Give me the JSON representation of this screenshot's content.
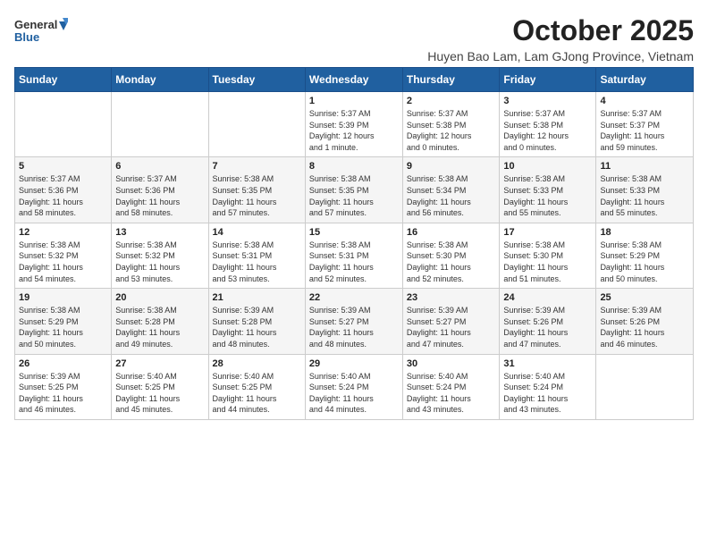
{
  "header": {
    "logo_general": "General",
    "logo_blue": "Blue",
    "month_title": "October 2025",
    "subtitle": "Huyen Bao Lam, Lam GJong Province, Vietnam"
  },
  "weekdays": [
    "Sunday",
    "Monday",
    "Tuesday",
    "Wednesday",
    "Thursday",
    "Friday",
    "Saturday"
  ],
  "weeks": [
    [
      {
        "day": "",
        "info": ""
      },
      {
        "day": "",
        "info": ""
      },
      {
        "day": "",
        "info": ""
      },
      {
        "day": "1",
        "info": "Sunrise: 5:37 AM\nSunset: 5:39 PM\nDaylight: 12 hours\nand 1 minute."
      },
      {
        "day": "2",
        "info": "Sunrise: 5:37 AM\nSunset: 5:38 PM\nDaylight: 12 hours\nand 0 minutes."
      },
      {
        "day": "3",
        "info": "Sunrise: 5:37 AM\nSunset: 5:38 PM\nDaylight: 12 hours\nand 0 minutes."
      },
      {
        "day": "4",
        "info": "Sunrise: 5:37 AM\nSunset: 5:37 PM\nDaylight: 11 hours\nand 59 minutes."
      }
    ],
    [
      {
        "day": "5",
        "info": "Sunrise: 5:37 AM\nSunset: 5:36 PM\nDaylight: 11 hours\nand 58 minutes."
      },
      {
        "day": "6",
        "info": "Sunrise: 5:37 AM\nSunset: 5:36 PM\nDaylight: 11 hours\nand 58 minutes."
      },
      {
        "day": "7",
        "info": "Sunrise: 5:38 AM\nSunset: 5:35 PM\nDaylight: 11 hours\nand 57 minutes."
      },
      {
        "day": "8",
        "info": "Sunrise: 5:38 AM\nSunset: 5:35 PM\nDaylight: 11 hours\nand 57 minutes."
      },
      {
        "day": "9",
        "info": "Sunrise: 5:38 AM\nSunset: 5:34 PM\nDaylight: 11 hours\nand 56 minutes."
      },
      {
        "day": "10",
        "info": "Sunrise: 5:38 AM\nSunset: 5:33 PM\nDaylight: 11 hours\nand 55 minutes."
      },
      {
        "day": "11",
        "info": "Sunrise: 5:38 AM\nSunset: 5:33 PM\nDaylight: 11 hours\nand 55 minutes."
      }
    ],
    [
      {
        "day": "12",
        "info": "Sunrise: 5:38 AM\nSunset: 5:32 PM\nDaylight: 11 hours\nand 54 minutes."
      },
      {
        "day": "13",
        "info": "Sunrise: 5:38 AM\nSunset: 5:32 PM\nDaylight: 11 hours\nand 53 minutes."
      },
      {
        "day": "14",
        "info": "Sunrise: 5:38 AM\nSunset: 5:31 PM\nDaylight: 11 hours\nand 53 minutes."
      },
      {
        "day": "15",
        "info": "Sunrise: 5:38 AM\nSunset: 5:31 PM\nDaylight: 11 hours\nand 52 minutes."
      },
      {
        "day": "16",
        "info": "Sunrise: 5:38 AM\nSunset: 5:30 PM\nDaylight: 11 hours\nand 52 minutes."
      },
      {
        "day": "17",
        "info": "Sunrise: 5:38 AM\nSunset: 5:30 PM\nDaylight: 11 hours\nand 51 minutes."
      },
      {
        "day": "18",
        "info": "Sunrise: 5:38 AM\nSunset: 5:29 PM\nDaylight: 11 hours\nand 50 minutes."
      }
    ],
    [
      {
        "day": "19",
        "info": "Sunrise: 5:38 AM\nSunset: 5:29 PM\nDaylight: 11 hours\nand 50 minutes."
      },
      {
        "day": "20",
        "info": "Sunrise: 5:38 AM\nSunset: 5:28 PM\nDaylight: 11 hours\nand 49 minutes."
      },
      {
        "day": "21",
        "info": "Sunrise: 5:39 AM\nSunset: 5:28 PM\nDaylight: 11 hours\nand 48 minutes."
      },
      {
        "day": "22",
        "info": "Sunrise: 5:39 AM\nSunset: 5:27 PM\nDaylight: 11 hours\nand 48 minutes."
      },
      {
        "day": "23",
        "info": "Sunrise: 5:39 AM\nSunset: 5:27 PM\nDaylight: 11 hours\nand 47 minutes."
      },
      {
        "day": "24",
        "info": "Sunrise: 5:39 AM\nSunset: 5:26 PM\nDaylight: 11 hours\nand 47 minutes."
      },
      {
        "day": "25",
        "info": "Sunrise: 5:39 AM\nSunset: 5:26 PM\nDaylight: 11 hours\nand 46 minutes."
      }
    ],
    [
      {
        "day": "26",
        "info": "Sunrise: 5:39 AM\nSunset: 5:25 PM\nDaylight: 11 hours\nand 46 minutes."
      },
      {
        "day": "27",
        "info": "Sunrise: 5:40 AM\nSunset: 5:25 PM\nDaylight: 11 hours\nand 45 minutes."
      },
      {
        "day": "28",
        "info": "Sunrise: 5:40 AM\nSunset: 5:25 PM\nDaylight: 11 hours\nand 44 minutes."
      },
      {
        "day": "29",
        "info": "Sunrise: 5:40 AM\nSunset: 5:24 PM\nDaylight: 11 hours\nand 44 minutes."
      },
      {
        "day": "30",
        "info": "Sunrise: 5:40 AM\nSunset: 5:24 PM\nDaylight: 11 hours\nand 43 minutes."
      },
      {
        "day": "31",
        "info": "Sunrise: 5:40 AM\nSunset: 5:24 PM\nDaylight: 11 hours\nand 43 minutes."
      },
      {
        "day": "",
        "info": ""
      }
    ]
  ]
}
